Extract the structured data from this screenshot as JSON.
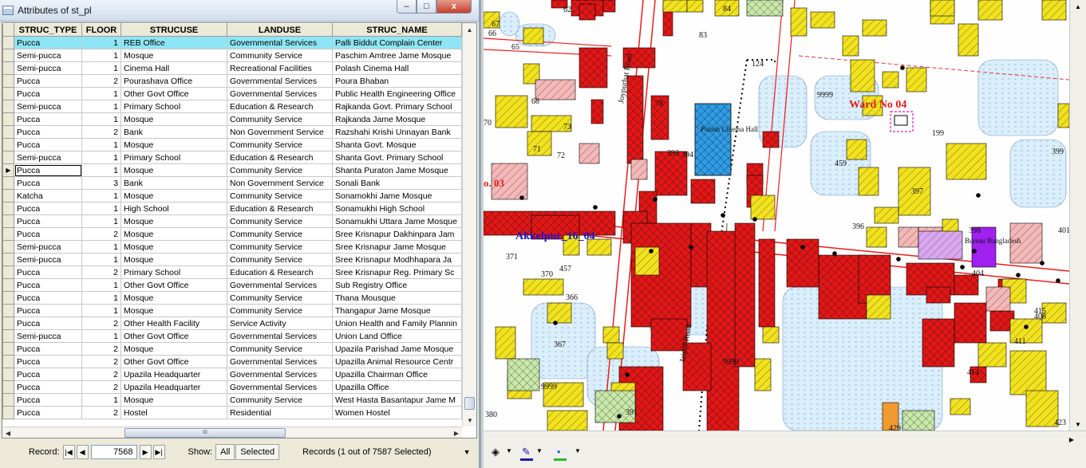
{
  "window": {
    "title": "Attributes of st_pl",
    "controls": {
      "minimize": "–",
      "maximize": "□",
      "close": "x"
    }
  },
  "table": {
    "columns": [
      "STRUC_TYPE",
      "FLOOR",
      "STRUCUSE",
      "LANDUSE",
      "STRUC_NAME"
    ],
    "rows": [
      [
        "Pucca",
        "1",
        "REB Office",
        "Governmental Services",
        "Palli Biddut Complain Center"
      ],
      [
        "Semi-pucca",
        "1",
        "Mosque",
        "Community Service",
        "Paschim Amtree Jame Mosque"
      ],
      [
        "Semi-pucca",
        "1",
        "Cinema Hall",
        "Recreational Facilities",
        "Polash Cinema Hall"
      ],
      [
        "Pucca",
        "2",
        "Pourashava Office",
        "Governmental Services",
        "Poura Bhaban"
      ],
      [
        "Pucca",
        "1",
        "Other Govt Office",
        "Governmental Services",
        "Public Health Engineering Office"
      ],
      [
        "Semi-pucca",
        "1",
        "Primary School",
        "Education & Research",
        "Rajkanda Govt. Primary School"
      ],
      [
        "Pucca",
        "1",
        "Mosque",
        "Community Service",
        "Rajkanda Jame Mosque"
      ],
      [
        "Pucca",
        "2",
        "Bank",
        "Non Government Service",
        "Razshahi Krishi Unnayan Bank"
      ],
      [
        "Pucca",
        "1",
        "Mosque",
        "Community Service",
        "Shanta Govt. Mosque"
      ],
      [
        "Semi-pucca",
        "1",
        "Primary School",
        "Education & Research",
        "Shanta Govt. Primary School"
      ],
      [
        "Pucca",
        "1",
        "Mosque",
        "Community Service",
        "Shanta Puraton Jame Mosque"
      ],
      [
        "Pucca",
        "3",
        "Bank",
        "Non Government Service",
        "Sonali Bank"
      ],
      [
        "Katcha",
        "1",
        "Mosque",
        "Community Service",
        "Sonamokhi Jame Mosque"
      ],
      [
        "Pucca",
        "1",
        "High School",
        "Education & Research",
        "Sonamukhi High School"
      ],
      [
        "Pucca",
        "1",
        "Mosque",
        "Community Service",
        "Sonamukhi Uttara Jame Mosque"
      ],
      [
        "Pucca",
        "2",
        "Mosque",
        "Community Service",
        "Sree Krisnapur Dakhinpara Jam"
      ],
      [
        "Semi-pucca",
        "1",
        "Mosque",
        "Community Service",
        "Sree Krisnapur Jame Mosque"
      ],
      [
        "Semi-pucca",
        "1",
        "Mosque",
        "Community Service",
        "Sree Krisnapur Modhhapara Ja"
      ],
      [
        "Pucca",
        "2",
        "Primary School",
        "Education & Research",
        "Sree Krisnapur Reg. Primary Sc"
      ],
      [
        "Pucca",
        "1",
        "Other Govt Office",
        "Governmental Services",
        "Sub Registry Office"
      ],
      [
        "Pucca",
        "1",
        "Mosque",
        "Community Service",
        "Thana Mousque"
      ],
      [
        "Pucca",
        "1",
        "Mosque",
        "Community Service",
        "Thangapur Jame Mosque"
      ],
      [
        "Pucca",
        "2",
        "Other Health Facility",
        "Service Activity",
        "Union Health and Family Plannin"
      ],
      [
        "Semi-pucca",
        "1",
        "Other Govt Office",
        "Governmental Services",
        "Union Land Office"
      ],
      [
        "Pucca",
        "2",
        "Mosque",
        "Community Service",
        "Upazila Parishad Jame Mosque"
      ],
      [
        "Pucca",
        "2",
        "Other Govt Office",
        "Governmental Services",
        "Upazilla Animal Resource Centr"
      ],
      [
        "Pucca",
        "2",
        "Upazila Headquarter",
        "Governmental Services",
        "Upazilla Chairman Office"
      ],
      [
        "Pucca",
        "2",
        "Upazila Headquarter",
        "Governmental Services",
        "Upazilla Office"
      ],
      [
        "Pucca",
        "1",
        "Mosque",
        "Community Service",
        "West Hasta Basantapur Jame M"
      ],
      [
        "Pucca",
        "2",
        "Hostel",
        "Residential",
        "Women Hostel"
      ]
    ],
    "highlighted_row": 0,
    "current_row": 10,
    "scroll_thumb_label": "III"
  },
  "status": {
    "record_label": "Record:",
    "record_value": "7568",
    "show_label": "Show:",
    "show_all": "All",
    "show_selected": "Selected",
    "records_text": "Records (1 out of 7587 Selected)"
  },
  "map": {
    "labels": {
      "ward": "Ward No 04",
      "akkelpur": "Akkelpur_16_04",
      "ward_left": "o. 03",
      "road1": "Joypurhat Road",
      "road2": "Jaipur Road",
      "polash": "Polash Cinema Hall",
      "bureau": "Bureau Bangladesh",
      "nums": [
        "62",
        "84",
        "65",
        "83",
        "124",
        "78",
        "9999",
        "199",
        "68",
        "70",
        "73",
        "71",
        "72",
        "393",
        "394",
        "459",
        "399",
        "397",
        "396",
        "398",
        "401",
        "404",
        "371",
        "370",
        "457",
        "366",
        "367",
        "9999",
        "9999",
        "414",
        "423",
        "380",
        "391",
        "411",
        "408",
        "415",
        "429",
        "66",
        "67"
      ]
    },
    "colors": {
      "pucca": "#ee1c1c",
      "semi": "#f2e21a",
      "katcha": "#c9e9a9",
      "water": "#dbeefb",
      "road": "#e8333b",
      "highlight": "#2f9de4",
      "purple": "#a020f0",
      "ward_label": "#e0201a",
      "akkelpur_label": "#1616c8"
    }
  },
  "toolbar": {
    "icons": [
      "fill-color-icon",
      "line-color-icon",
      "marker-color-icon"
    ]
  }
}
